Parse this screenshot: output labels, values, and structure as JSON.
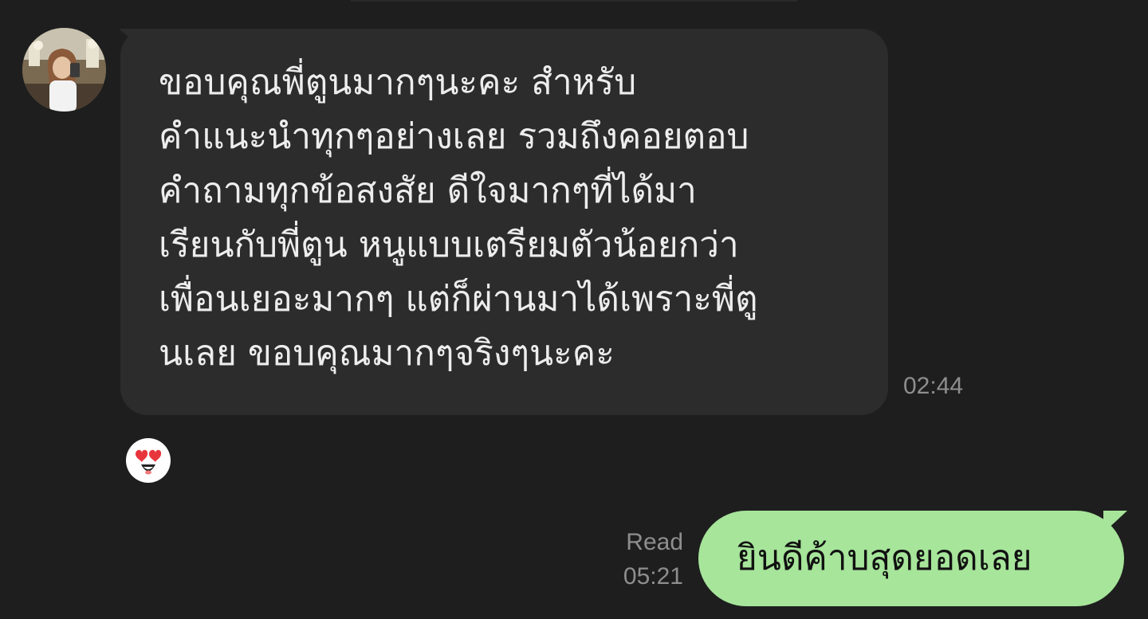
{
  "colors": {
    "background": "#1e1e1e",
    "incoming_bubble": "#2c2c2c",
    "outgoing_bubble": "#a6e59a",
    "meta_text": "#8e8e8e"
  },
  "incoming": {
    "avatar_icon": "contact-avatar",
    "text": "ขอบคุณพี่ตูนมากๆนะคะ สำหรับ\nคำแนะนำทุกๆอย่างเลย รวมถึงคอยตอบ\nคำถามทุกข้อสงสัย ดีใจมากๆที่ได้มา\nเรียนกับพี่ตูน หนูแบบเตรียมตัวน้อยกว่า\nเพื่อนเยอะมากๆ แต่ก็ผ่านมาได้เพราะพี่ตู\nนเลย ขอบคุณมากๆจริงๆนะคะ",
    "time": "02:44",
    "reaction_icon": "heart-eyes-emoji"
  },
  "outgoing": {
    "text": "ยินดีค้าบสุดยอดเลย",
    "read_label": "Read",
    "time": "05:21"
  }
}
